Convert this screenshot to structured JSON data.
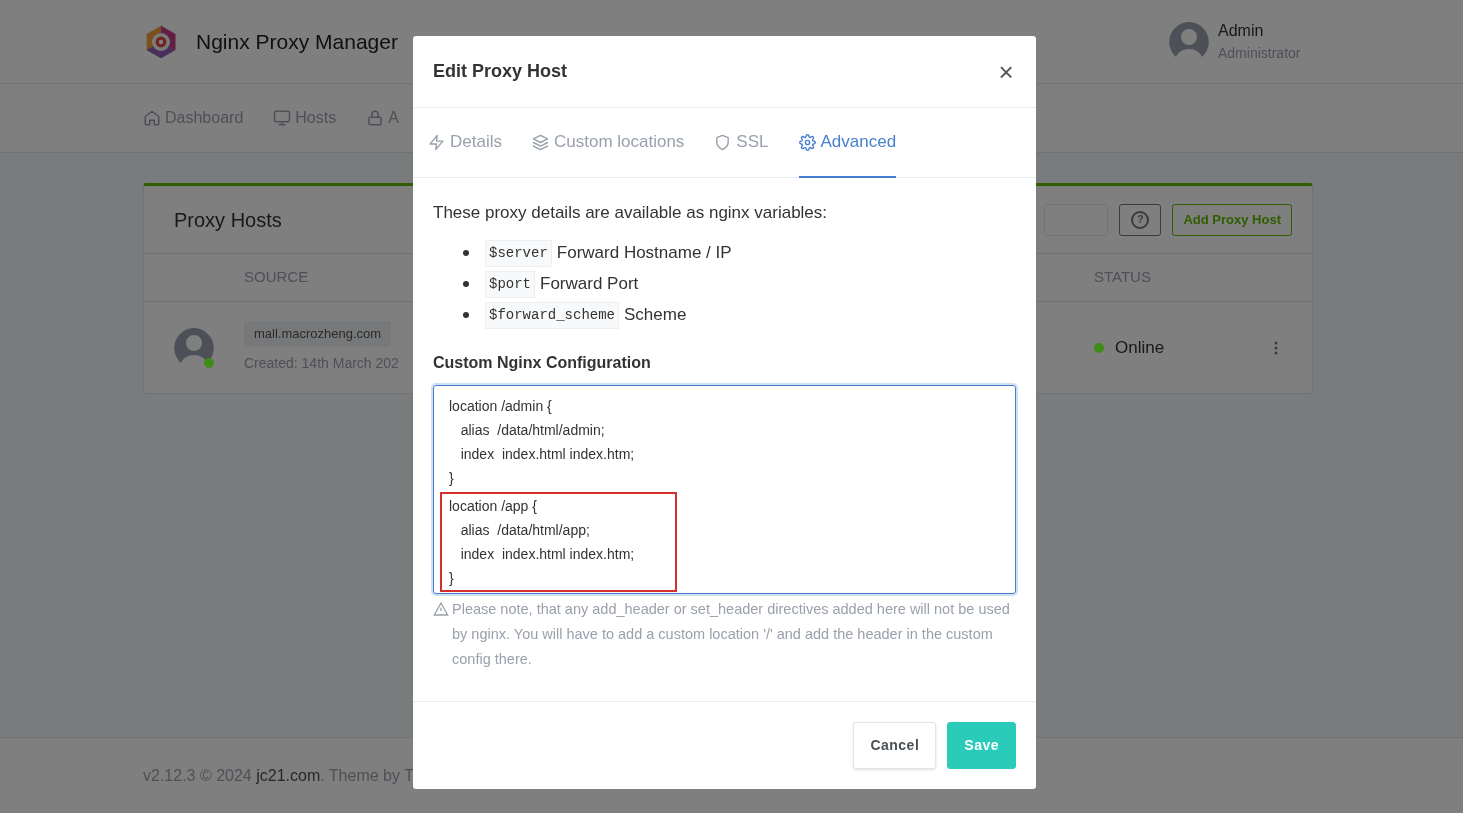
{
  "app": {
    "title": "Nginx Proxy Manager"
  },
  "user": {
    "name": "Admin",
    "role": "Administrator"
  },
  "nav": [
    {
      "label": "Dashboard"
    },
    {
      "label": "Hosts"
    },
    {
      "label": "A"
    }
  ],
  "card": {
    "title": "Proxy Hosts",
    "help": "?",
    "add_button": "Add Proxy Host",
    "columns": [
      "SOURCE",
      "STATUS"
    ],
    "rows": [
      {
        "domain": "mall.macrozheng.com",
        "created": "Created: 14th March 202",
        "status": "Online",
        "color": "#3d8c16"
      }
    ]
  },
  "footer": {
    "before": "v2.12.3 © 2024 ",
    "link": "jc21.com",
    "after": ". Theme by T"
  },
  "modal": {
    "title": "Edit Proxy Host",
    "close": "×",
    "tabs": [
      {
        "label": "Details",
        "selected": false
      },
      {
        "label": "Custom locations",
        "selected": false
      },
      {
        "label": "SSL",
        "selected": false
      },
      {
        "label": "Advanced",
        "selected": true
      }
    ],
    "intro": "These proxy details are available as nginx variables:",
    "variables": [
      {
        "code": "$server",
        "label": "Forward Hostname / IP"
      },
      {
        "code": "$port",
        "label": "Forward Port"
      },
      {
        "code": "$forward_scheme",
        "label": "Scheme"
      }
    ],
    "config_label": "Custom Nginx Configuration",
    "config_blocks": [
      {
        "lines": [
          "location /admin {",
          "   alias  /data/html/admin;",
          "   index  index.html index.htm;",
          "}"
        ],
        "highlighted": false
      },
      {
        "lines": [
          "location /app {",
          "   alias  /data/html/app;",
          "   index  index.html index.htm;",
          "}"
        ],
        "highlighted": true
      }
    ],
    "note": "Please note, that any add_header or set_header directives added here will not be used by nginx. You will have to add a custom location '/' and add the header in the custom config there.",
    "buttons": [
      {
        "label": "Cancel",
        "kind": "secondary"
      },
      {
        "label": "Save",
        "kind": "primary"
      }
    ]
  }
}
